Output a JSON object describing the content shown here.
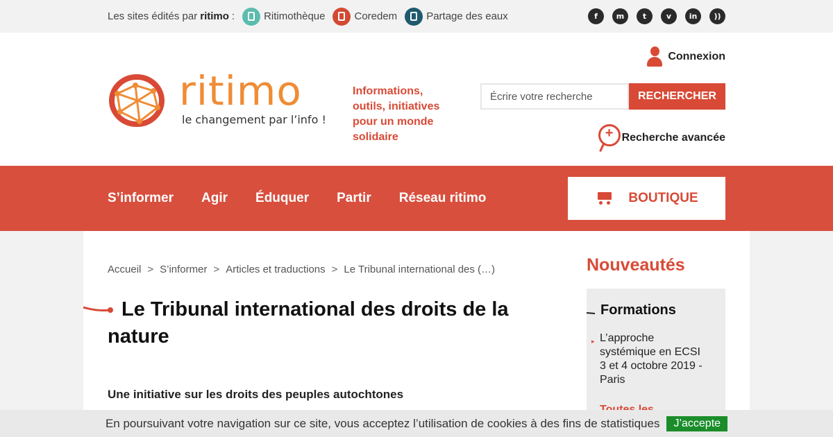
{
  "topbar": {
    "intro_prefix": "Les sites édités par",
    "intro_brand": "ritimo",
    "intro_suffix": ":",
    "sites": [
      {
        "label": "Ritimothèque",
        "icon": "book-icon"
      },
      {
        "label": "Coredem",
        "icon": "coredem-icon"
      },
      {
        "label": "Partage des eaux",
        "icon": "water-drop-icon"
      }
    ],
    "social": [
      {
        "name": "facebook-icon",
        "glyph": "f"
      },
      {
        "name": "mastodon-icon",
        "glyph": "m"
      },
      {
        "name": "twitter-icon",
        "glyph": "t"
      },
      {
        "name": "vimeo-icon",
        "glyph": "v"
      },
      {
        "name": "linkedin-icon",
        "glyph": "in"
      },
      {
        "name": "rss-icon",
        "glyph": "))"
      }
    ]
  },
  "header": {
    "logo_word": "ritimo",
    "logo_tagline": "le changement par l’info !",
    "tagline": "Informations, outils, initiatives pour un monde solidaire",
    "login_label": "Connexion",
    "search_placeholder": "Écrire votre recherche",
    "search_button": "RECHERCHER",
    "advanced_search": "Recherche avancée"
  },
  "nav": {
    "items": [
      "S’informer",
      "Agir",
      "Éduquer",
      "Partir",
      "Réseau ritimo"
    ],
    "shop_label": "BOUTIQUE"
  },
  "breadcrumb": {
    "items": [
      "Accueil",
      "S’informer",
      "Articles et traductions",
      "Le Tribunal international des (…)"
    ],
    "separator": ">"
  },
  "article": {
    "title": "Le Tribunal international des droits de la nature",
    "subtitle": "Une initiative sur les droits des peuples autochtones"
  },
  "sidebar": {
    "title": "Nouveautés",
    "box_title": "Formations",
    "item_title": "L’approche systémique en ECSI",
    "item_detail": "3 et 4 octobre 2019 - Paris",
    "more_label": "Toutes les"
  },
  "cookie": {
    "text": "En poursuivant votre navigation sur ce site, vous acceptez l’utilisation de cookies à des fins de statistiques",
    "accept": "J’accepte"
  },
  "colors": {
    "brand_red": "#d84f3d",
    "logo_orange": "#ef8c35",
    "accept_green": "#1a8d2a"
  }
}
